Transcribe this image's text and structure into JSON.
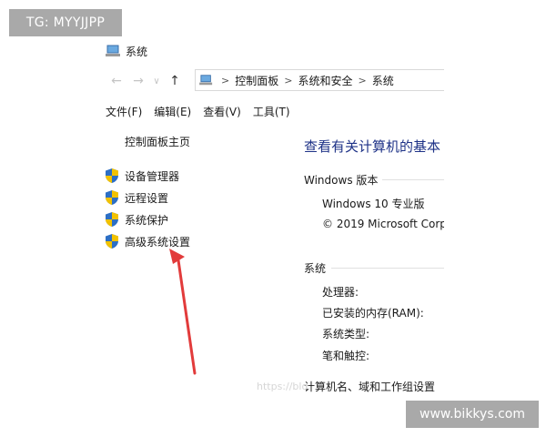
{
  "overlay_tag": "TG: MYYJJPP",
  "watermark": "www.bikkys.com",
  "faint_watermark": "https://blo",
  "window": {
    "title": "系统",
    "icon": "computer-icon",
    "nav": {
      "back_icon": "←",
      "forward_icon": "→",
      "dropdown_icon": "∨",
      "up_icon": "↑"
    },
    "address": {
      "icon": "computer-icon",
      "crumbs": [
        "控制面板",
        "系统和安全",
        "系统"
      ],
      "separator": ">"
    },
    "menu": [
      "文件(F)",
      "编辑(E)",
      "查看(V)",
      "工具(T)"
    ],
    "sidebar": {
      "home": "控制面板主页",
      "links": [
        {
          "label": "设备管理器",
          "icon": "uac-shield-icon"
        },
        {
          "label": "远程设置",
          "icon": "uac-shield-icon"
        },
        {
          "label": "系统保护",
          "icon": "uac-shield-icon"
        },
        {
          "label": "高级系统设置",
          "icon": "uac-shield-icon"
        }
      ]
    },
    "main": {
      "heading": "查看有关计算机的基本",
      "windows_edition": {
        "label": "Windows 版本",
        "edition": "Windows 10 专业版",
        "copyright": "© 2019 Microsoft Corp"
      },
      "system": {
        "label": "系统",
        "rows": [
          "处理器:",
          "已安装的内存(RAM):",
          "系统类型:",
          "笔和触控:"
        ]
      },
      "computer_name_label": "计算机名、域和工作组设置"
    }
  },
  "annotation": {
    "icon": "red-arrow-icon",
    "color": "#e23b3b"
  },
  "colors": {
    "heading": "#1e3287",
    "overlay": "#a9a9a9",
    "shield_blue": "#2d6fc5",
    "shield_yellow": "#f2c200"
  }
}
